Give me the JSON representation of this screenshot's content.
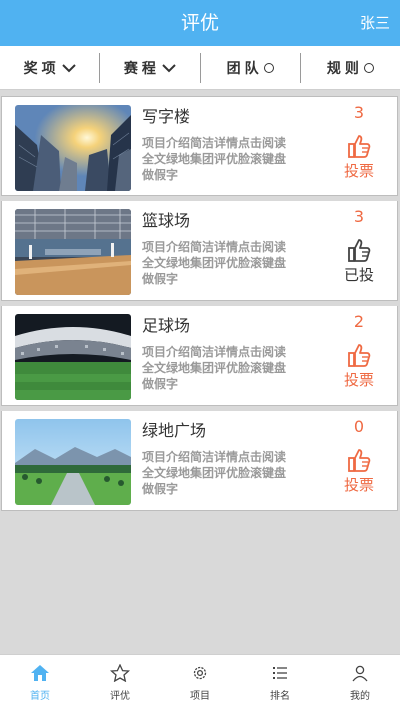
{
  "header": {
    "title": "评优",
    "user": "张三"
  },
  "filters": [
    {
      "label": "奖项",
      "icon": "chevron-down-icon"
    },
    {
      "label": "赛程",
      "icon": "chevron-down-icon"
    },
    {
      "label": "团队",
      "icon": "circle-icon"
    },
    {
      "label": "规则",
      "icon": "circle-icon"
    }
  ],
  "items": [
    {
      "name": "写字楼",
      "desc": "项目介绍简洁详情点击阅读全文绿地集团评优脸滚键盘做假字",
      "count": "3",
      "vote_label": "投票",
      "voted": false
    },
    {
      "name": "篮球场",
      "desc": "项目介绍简洁详情点击阅读全文绿地集团评优脸滚键盘做假字",
      "count": "3",
      "vote_label": "已投",
      "voted": true
    },
    {
      "name": "足球场",
      "desc": "项目介绍简洁详情点击阅读全文绿地集团评优脸滚键盘做假字",
      "count": "2",
      "vote_label": "投票",
      "voted": false
    },
    {
      "name": "绿地广场",
      "desc": "项目介绍简洁详情点击阅读全文绿地集团评优脸滚键盘做假字",
      "count": "0",
      "vote_label": "投票",
      "voted": false
    }
  ],
  "tabs": [
    {
      "label": "首页",
      "icon": "home-icon",
      "active": true
    },
    {
      "label": "评优",
      "icon": "star-icon",
      "active": false
    },
    {
      "label": "项目",
      "icon": "gear-icon",
      "active": false
    },
    {
      "label": "排名",
      "icon": "list-icon",
      "active": false
    },
    {
      "label": "我的",
      "icon": "person-icon",
      "active": false
    }
  ],
  "colors": {
    "accent": "#50b2f1",
    "vote": "#ef6a43",
    "background": "#d9d9d9"
  }
}
